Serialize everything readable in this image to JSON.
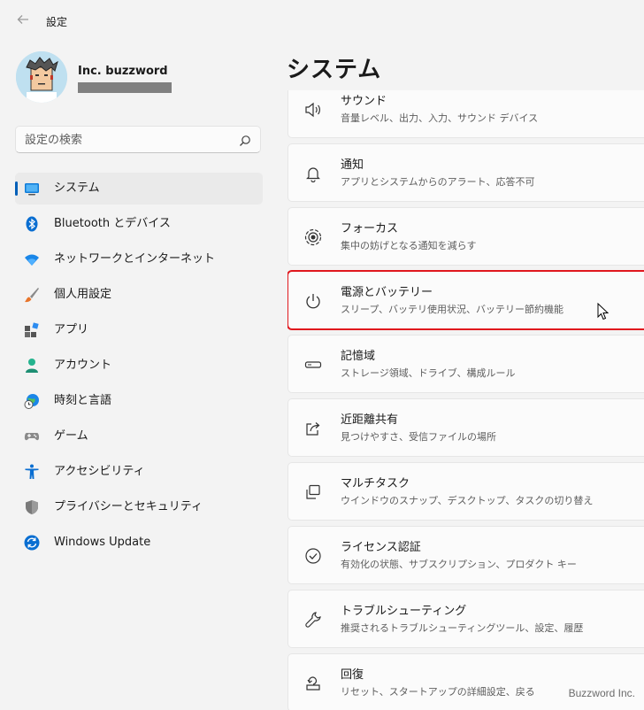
{
  "window": {
    "title": "設定"
  },
  "user": {
    "name": "Inc. buzzword"
  },
  "search": {
    "placeholder": "設定の検索"
  },
  "sidebar": {
    "items": [
      {
        "label": "システム",
        "icon": "system-monitor-icon",
        "active": true
      },
      {
        "label": "Bluetooth とデバイス",
        "icon": "bluetooth-icon"
      },
      {
        "label": "ネットワークとインターネット",
        "icon": "wifi-icon"
      },
      {
        "label": "個人用設定",
        "icon": "paintbrush-icon"
      },
      {
        "label": "アプリ",
        "icon": "apps-icon"
      },
      {
        "label": "アカウント",
        "icon": "account-icon"
      },
      {
        "label": "時刻と言語",
        "icon": "globe-clock-icon"
      },
      {
        "label": "ゲーム",
        "icon": "gamepad-icon"
      },
      {
        "label": "アクセシビリティ",
        "icon": "accessibility-icon"
      },
      {
        "label": "プライバシーとセキュリティ",
        "icon": "shield-icon"
      },
      {
        "label": "Windows Update",
        "icon": "windows-update-icon"
      }
    ]
  },
  "main": {
    "title": "システム",
    "cards": [
      {
        "title": "サウンド",
        "subtitle": "音量レベル、出力、入力、サウンド デバイス",
        "icon": "speaker-icon"
      },
      {
        "title": "通知",
        "subtitle": "アプリとシステムからのアラート、応答不可",
        "icon": "bell-icon"
      },
      {
        "title": "フォーカス",
        "subtitle": "集中の妨げとなる通知を減らす",
        "icon": "focus-icon"
      },
      {
        "title": "電源とバッテリー",
        "subtitle": "スリープ、バッテリ使用状況、バッテリー節約機能",
        "icon": "power-icon",
        "highlighted": true
      },
      {
        "title": "記憶域",
        "subtitle": "ストレージ領域、ドライブ、構成ルール",
        "icon": "storage-icon"
      },
      {
        "title": "近距離共有",
        "subtitle": "見つけやすさ、受信ファイルの場所",
        "icon": "share-icon"
      },
      {
        "title": "マルチタスク",
        "subtitle": "ウインドウのスナップ、デスクトップ、タスクの切り替え",
        "icon": "multitask-icon"
      },
      {
        "title": "ライセンス認証",
        "subtitle": "有効化の状態、サブスクリプション、プロダクト キー",
        "icon": "check-circle-icon"
      },
      {
        "title": "トラブルシューティング",
        "subtitle": "推奨されるトラブルシューティングツール、設定、履歴",
        "icon": "wrench-icon"
      },
      {
        "title": "回復",
        "subtitle": "リセット、スタートアップの詳細設定、戻る",
        "icon": "recovery-icon"
      }
    ]
  },
  "watermark": "Buzzword Inc.",
  "colors": {
    "accent": "#005fb8",
    "highlight": "#e0181e",
    "background": "#f3f3f3",
    "card": "#fbfbfb"
  }
}
